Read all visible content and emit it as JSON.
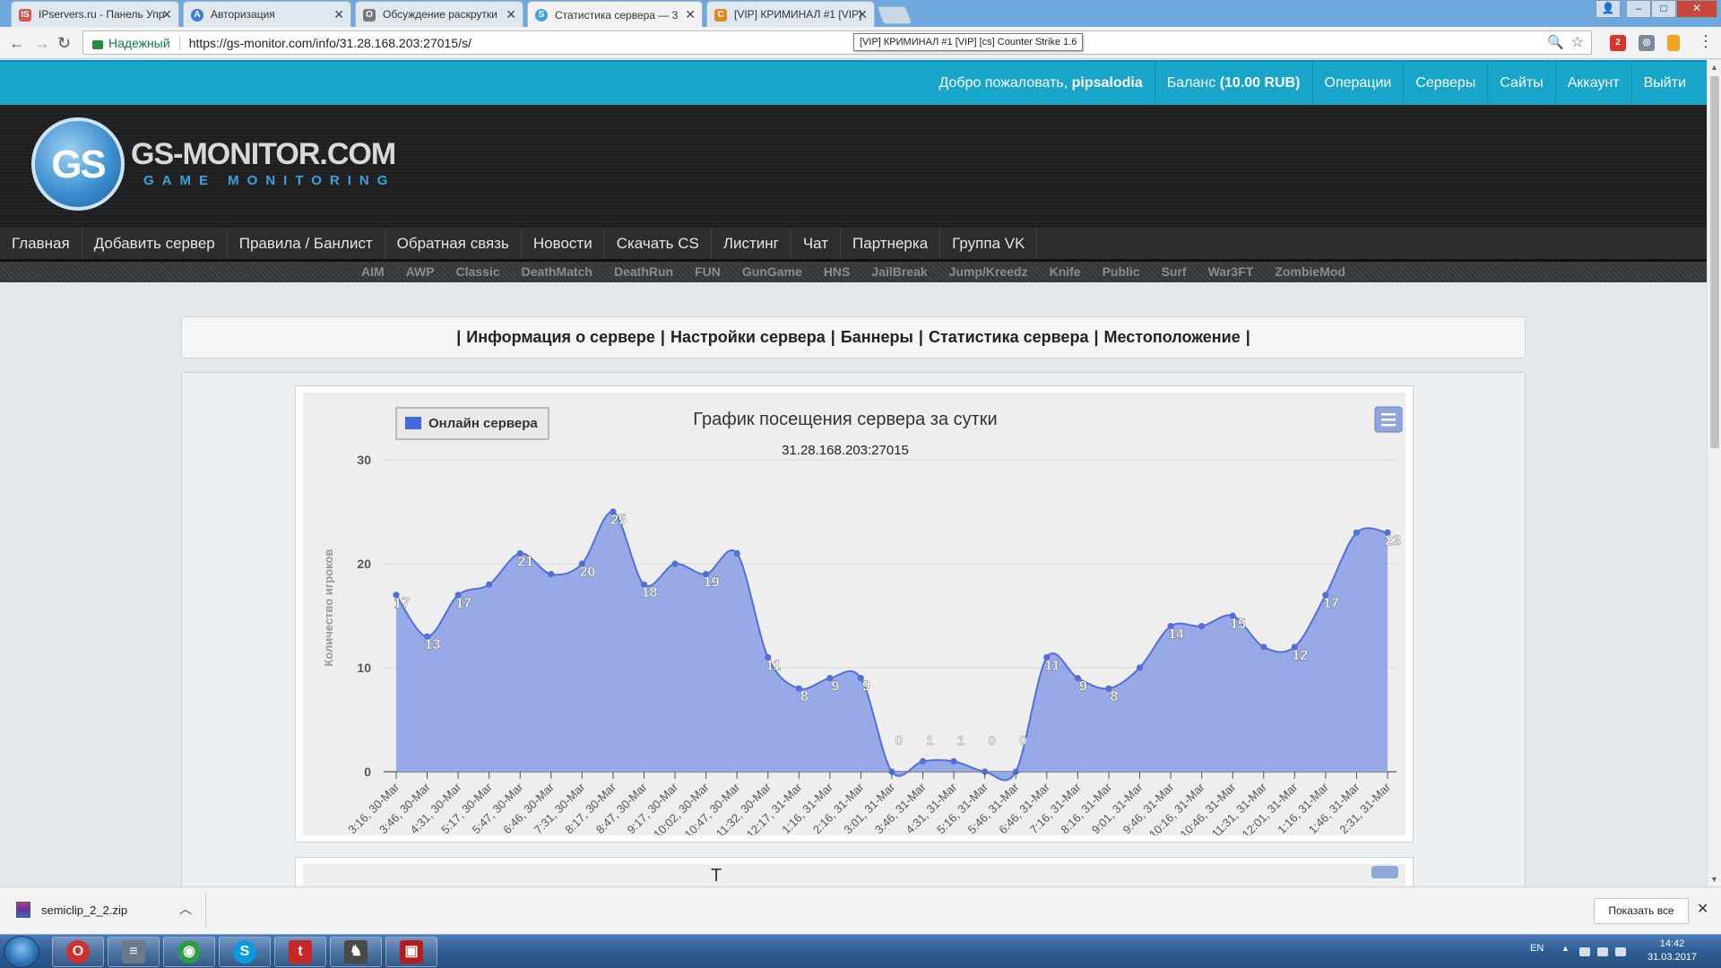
{
  "browser": {
    "tabs": [
      {
        "label": "IPservers.ru - Панель Упр",
        "favicon_color": "#d9534f",
        "favicon_text": "IS"
      },
      {
        "label": "Авторизация",
        "favicon_color": "#3d7ed0",
        "favicon_text": "A"
      },
      {
        "label": "Обсуждение раскрутки",
        "favicon_color": "#777777",
        "favicon_text": "O"
      },
      {
        "label": "Статистика сервера — 3",
        "favicon_color": "#3fa1dc",
        "favicon_text": "S"
      },
      {
        "label": "[VIP] КРИМИНАЛ #1 [VIP]",
        "favicon_color": "#e08a1e",
        "favicon_text": "C"
      }
    ],
    "active_tab_index": 3,
    "secure_label": "Надежный",
    "url": "https://gs-monitor.com/info/31.28.168.203:27015/s/",
    "tooltip": "[VIP] КРИМИНАЛ #1 [VIP] [cs] Counter Strike 1.6",
    "nav_icons": [
      "back-icon",
      "forward-icon",
      "reload-icon"
    ],
    "extensions": [
      {
        "name": "adblock-icon",
        "color": "#d9342b",
        "text": "2"
      },
      {
        "name": "shield-extension-icon",
        "color": "#7a8a99",
        "text": "◎"
      },
      {
        "name": "bookmark-extension-icon",
        "color": "#f1a321",
        "text": ""
      }
    ]
  },
  "site": {
    "topnav": {
      "welcome_prefix": "Добро пожаловать,",
      "username": "pipsalodia",
      "balance_prefix": "Баланс",
      "balance_value": "(10.00 RUB)",
      "operations": "Операции",
      "servers": "Серверы",
      "sites": "Сайты",
      "account": "Аккаунт",
      "logout": "Выйти"
    },
    "logo": {
      "badge": "GS",
      "title": "GS-MONITOR.COM",
      "subtitle": "GAME MONITORING"
    },
    "main_menu": [
      "Главная",
      "Добавить сервер",
      "Правила / Банлист",
      "Обратная связь",
      "Новости",
      "Скачать CS",
      "Листинг",
      "Чат",
      "Партнерка",
      "Группа VK"
    ],
    "sub_menu": [
      "AIM",
      "AWP",
      "Classic",
      "DeathMatch",
      "DeathRun",
      "FUN",
      "GunGame",
      "HNS",
      "JailBreak",
      "Jump/Kreedz",
      "Knife",
      "Public",
      "Surf",
      "War3FT",
      "ZombieMod"
    ],
    "server_tabs": [
      "Информация о сервере",
      "Настройки сервера",
      "Баннеры",
      "Статистика сервера",
      "Местоположение"
    ],
    "second_chart_title_fragment": "Т"
  },
  "chart_data": {
    "type": "area",
    "title": "График посещения сервера за сутки",
    "subtitle": "31.28.168.203:27015",
    "ylabel": "Количество игроков",
    "ylim": [
      0,
      30
    ],
    "yticks": [
      0,
      10,
      20,
      30
    ],
    "legend": {
      "label": "Онлайн сервера",
      "position": "top-left"
    },
    "color": "#5470d8",
    "fill_color": "#91a4e6",
    "grid": true,
    "x_tick_labels": [
      "3:16, 30-Mar",
      "3:46, 30-Mar",
      "4:31, 30-Mar",
      "5:17, 30-Mar",
      "5:47, 30-Mar",
      "6:46, 30-Mar",
      "7:31, 30-Mar",
      "8:17, 30-Mar",
      "8:47, 30-Mar",
      "9:17, 30-Mar",
      "10:02, 30-Mar",
      "10:47, 30-Mar",
      "11:32, 30-Mar",
      "12:17, 31-Mar",
      "1:16, 31-Mar",
      "2:16, 31-Mar",
      "3:01, 31-Mar",
      "3:46, 31-Mar",
      "4:31, 31-Mar",
      "5:16, 31-Mar",
      "5:46, 31-Mar",
      "6:46, 31-Mar",
      "7:16, 31-Mar",
      "8:16, 31-Mar",
      "9:01, 31-Mar",
      "9:46, 31-Mar",
      "10:16, 31-Mar",
      "10:46, 31-Mar",
      "11:31, 31-Mar",
      "12:01, 31-Mar",
      "1:16, 31-Mar",
      "1:46, 31-Mar",
      "2:31, 31-Mar"
    ],
    "values": [
      17,
      13,
      17,
      18,
      21,
      19,
      20,
      25,
      18,
      20,
      19,
      21,
      11,
      8,
      9,
      9,
      0,
      1,
      1,
      0,
      0,
      11,
      9,
      8,
      10,
      14,
      14,
      15,
      12,
      12,
      17,
      23,
      23
    ],
    "labeled_points": [
      {
        "index": 0,
        "text": "17"
      },
      {
        "index": 2,
        "text": "13"
      },
      {
        "index": 4,
        "text": "17"
      },
      {
        "index": 8,
        "text": "21"
      },
      {
        "index": 12,
        "text": "20"
      },
      {
        "index": 14,
        "text": "25"
      },
      {
        "index": 16,
        "text": "18"
      },
      {
        "index": 20,
        "text": "19"
      },
      {
        "index": 24,
        "text": "11"
      },
      {
        "index": 26,
        "text": "8"
      },
      {
        "index": 28,
        "text": "9"
      },
      {
        "index": 30,
        "text": "9"
      },
      {
        "index": 32,
        "text": "0"
      },
      {
        "index": 34,
        "text": "1"
      },
      {
        "index": 36,
        "text": "1"
      },
      {
        "index": 38,
        "text": "0"
      },
      {
        "index": 40,
        "text": "0"
      },
      {
        "index": 42,
        "text": "11"
      },
      {
        "index": 44,
        "text": "9"
      },
      {
        "index": 46,
        "text": "8"
      },
      {
        "index": 50,
        "text": "14"
      },
      {
        "index": 54,
        "text": "15"
      },
      {
        "index": 58,
        "text": "12"
      },
      {
        "index": 60,
        "text": "17"
      },
      {
        "index": 64,
        "text": "23"
      }
    ]
  },
  "download_bar": {
    "filename": "semiclip_2_2.zip",
    "show_all": "Показать все"
  },
  "taskbar": {
    "lang": "EN",
    "time": "14:42",
    "date": "31.03.2017",
    "pinned": [
      {
        "name": "opera-icon",
        "color": "#d32f2f",
        "glyph": "O"
      },
      {
        "name": "notepad-icon",
        "color": "#6b7a8a",
        "glyph": "≡"
      },
      {
        "name": "chrome-icon",
        "color": "#2e9b47",
        "glyph": "◉"
      },
      {
        "name": "skype-icon",
        "color": "#0a9be0",
        "glyph": "S"
      },
      {
        "name": "tumblr-icon",
        "color": "#c62828",
        "glyph": "t"
      },
      {
        "name": "counter-strike-icon",
        "color": "#4a4a4a",
        "glyph": "♞"
      },
      {
        "name": "save-disk-icon",
        "color": "#b71c1c",
        "glyph": "▣"
      }
    ]
  }
}
